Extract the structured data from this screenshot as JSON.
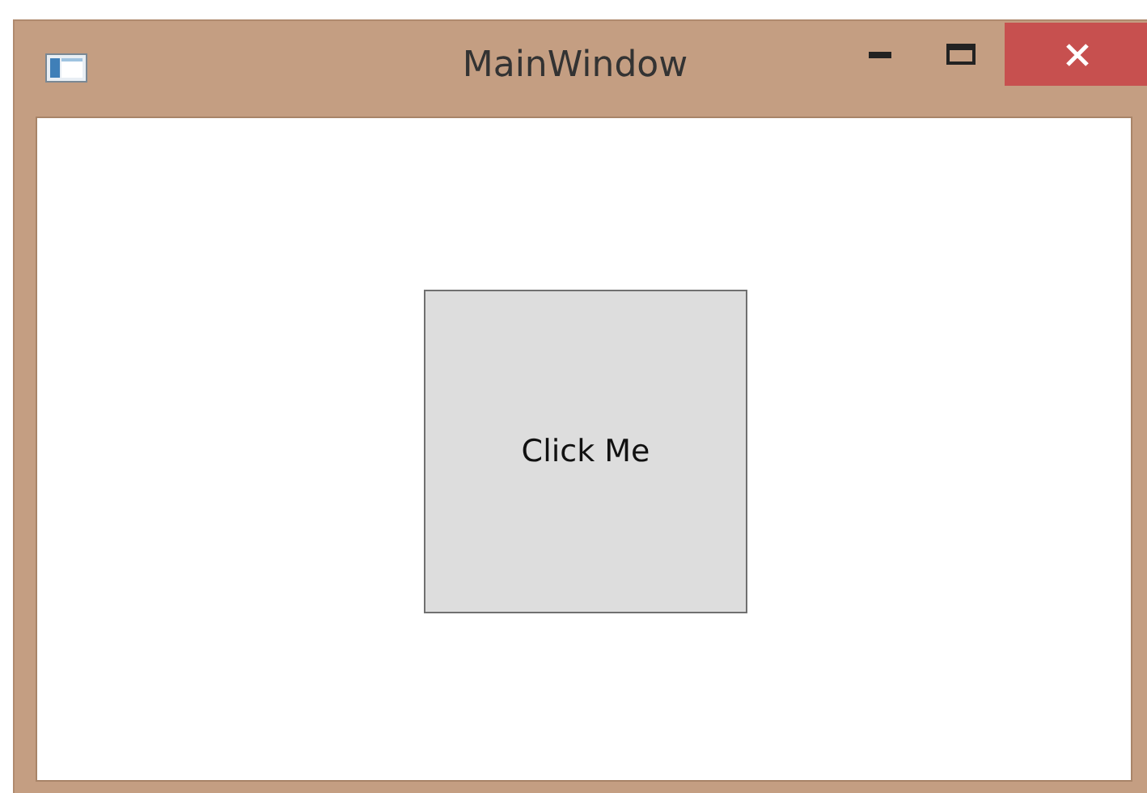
{
  "window": {
    "title": "MainWindow"
  },
  "button": {
    "label": "Click Me"
  }
}
